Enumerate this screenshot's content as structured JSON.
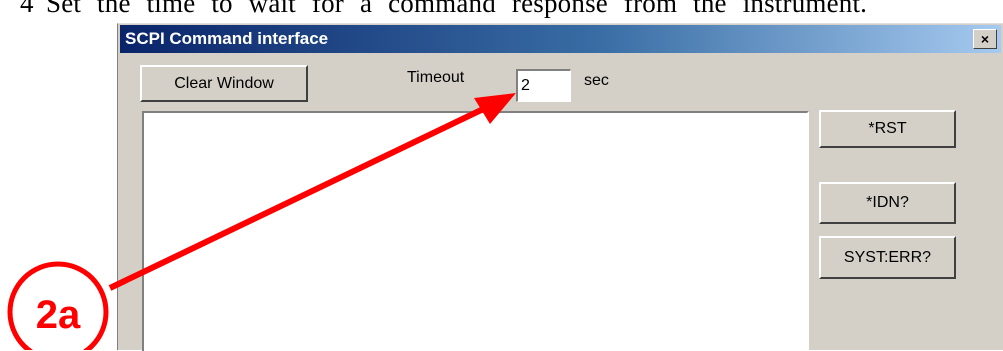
{
  "document": {
    "step_number": "4",
    "sentence": "Set the time to wait for a command response from the instrument."
  },
  "window": {
    "title": "SCPI Command interface",
    "close_glyph": "×"
  },
  "toolbar": {
    "clear_label": "Clear Window",
    "timeout_label": "Timeout",
    "timeout_value": "2",
    "timeout_unit": "sec"
  },
  "commands": [
    {
      "label": "*RST"
    },
    {
      "label": "*IDN?"
    },
    {
      "label": "SYST:ERR?"
    }
  ],
  "annotation": {
    "label": "2a",
    "color": "#ff0000"
  }
}
